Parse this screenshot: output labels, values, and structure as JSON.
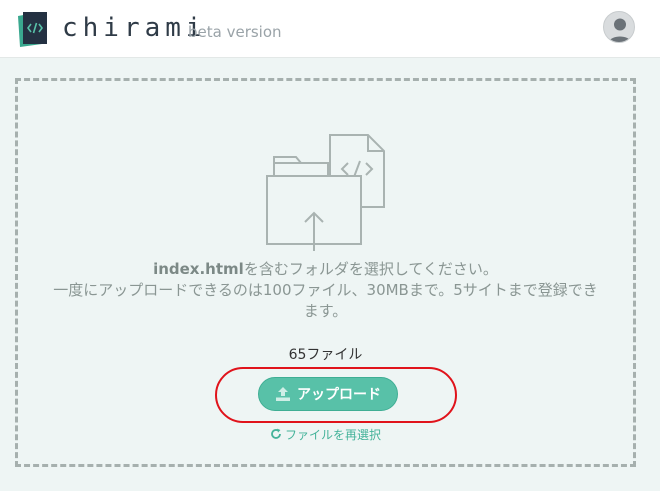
{
  "header": {
    "brand": "chirami",
    "beta_label": "beta version",
    "logo_icon": "code-document-icon",
    "avatar_icon": "user-avatar-icon"
  },
  "dropzone": {
    "illustration_icon": "folder-upload-code-file-icon",
    "instruction_bold": "index.html",
    "instruction_rest": "を含むフォルダを選択してください。",
    "instruction_line2": "一度にアップロードできるのは100ファイル、30MBまで。5サイトまで登録できます。",
    "file_count": "65ファイル",
    "upload_button_label": "アップロード",
    "reselect_label": "ファイルを再選択"
  },
  "colors": {
    "accent": "#58c1a8",
    "highlight": "#e0131b",
    "background": "#eef5f4",
    "dashed_border": "#a6b0ae"
  }
}
